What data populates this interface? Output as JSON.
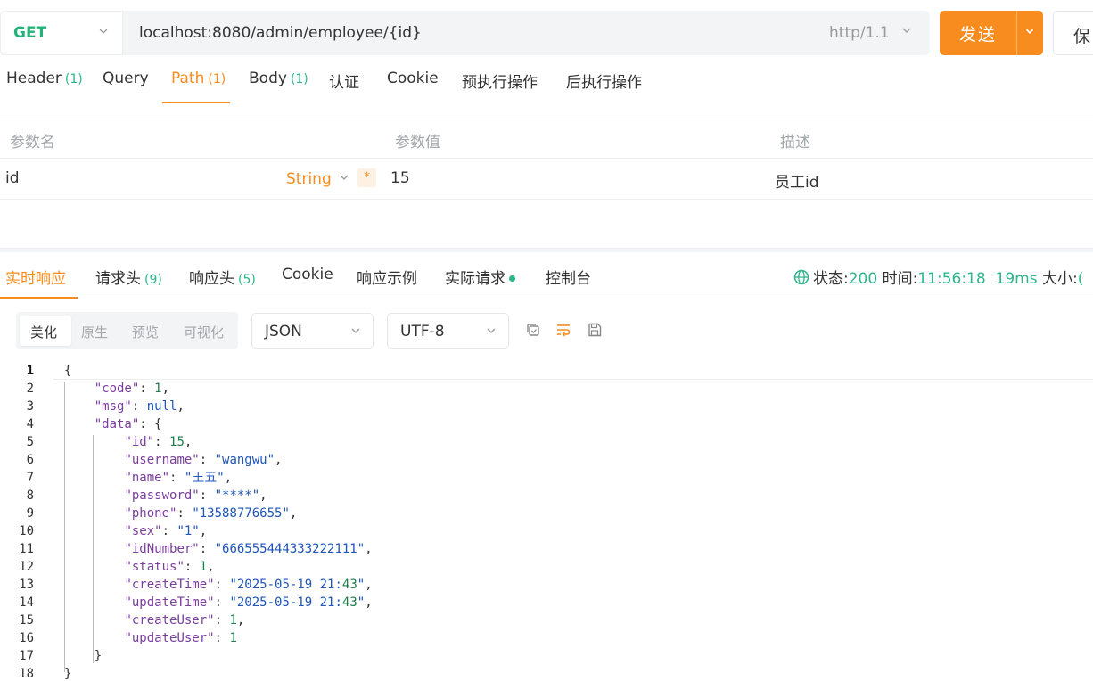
{
  "request": {
    "method": "GET",
    "url": "localhost:8080/admin/employee/{id}",
    "protocol": "http/1.1",
    "send_label": "发送",
    "save_label": "保"
  },
  "request_tabs": [
    {
      "label": "Header",
      "count": "(1)"
    },
    {
      "label": "Query",
      "count": ""
    },
    {
      "label": "Path",
      "count": "(1)",
      "active": true
    },
    {
      "label": "Body",
      "count": "(1)"
    },
    {
      "label": "认证",
      "count": ""
    },
    {
      "label": "Cookie",
      "count": ""
    },
    {
      "label": "预执行操作",
      "count": ""
    },
    {
      "label": "后执行操作",
      "count": ""
    }
  ],
  "params_table": {
    "headers": [
      "参数名",
      "参数值",
      "描述"
    ],
    "rows": [
      {
        "name": "id",
        "type": "String",
        "required": "*",
        "value": "15",
        "description": "员工id"
      }
    ]
  },
  "response_tabs": [
    {
      "label": "实时响应",
      "count": "",
      "active": true
    },
    {
      "label": "请求头",
      "count": "(9)"
    },
    {
      "label": "响应头",
      "count": "(5)"
    },
    {
      "label": "Cookie",
      "count": ""
    },
    {
      "label": "响应示例",
      "count": ""
    },
    {
      "label": "实际请求",
      "count": ""
    },
    {
      "label": "控制台",
      "count": ""
    }
  ],
  "response_status": {
    "status_label": "状态:",
    "status_value": "200",
    "time_label": "时间:",
    "time_value": "11:56:18",
    "duration": "19ms",
    "size_label": "大小:",
    "size_value": "("
  },
  "view_modes": [
    "美化",
    "原生",
    "预览",
    "可视化"
  ],
  "format": "JSON",
  "encoding": "UTF-8",
  "colors": {
    "accent": "#f98c1f",
    "success": "#2fb58a",
    "method_get": "#23b37a"
  },
  "code_lines": [
    "{",
    "    \"code\": 1,",
    "    \"msg\": null,",
    "    \"data\": {",
    "        \"id\": 15,",
    "        \"username\": \"wangwu\",",
    "        \"name\": \"王五\",",
    "        \"password\": \"****\",",
    "        \"phone\": \"13588776655\",",
    "        \"sex\": \"1\",",
    "        \"idNumber\": \"666555444333222111\",",
    "        \"status\": 1,",
    "        \"createTime\": \"2025-05-19 21:43\",",
    "        \"updateTime\": \"2025-05-19 21:43\",",
    "        \"createUser\": 1,",
    "        \"updateUser\": 1",
    "    }",
    "}"
  ]
}
